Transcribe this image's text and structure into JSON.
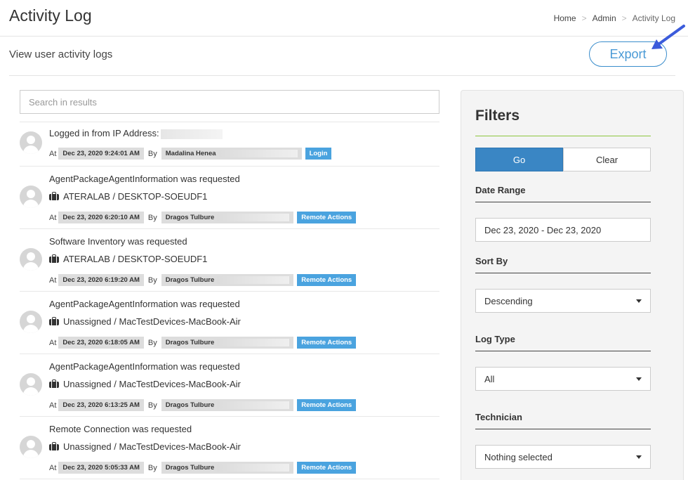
{
  "header": {
    "title": "Activity Log",
    "breadcrumb": [
      "Home",
      "Admin",
      "Activity Log"
    ],
    "separator": ">"
  },
  "subheader": {
    "subtitle": "View user activity logs",
    "export_label": "Export"
  },
  "search": {
    "placeholder": "Search in results"
  },
  "log_labels": {
    "at": "At",
    "by": "By"
  },
  "logs": [
    {
      "title": "Logged in from IP Address:",
      "device": "",
      "date": "Dec 23, 2020 9:24:01 AM",
      "user": "Madalina Henea",
      "type": "Login"
    },
    {
      "title": "AgentPackageAgentInformation was requested",
      "device": "ATERALAB / DESKTOP-SOEUDF1",
      "date": "Dec 23, 2020 6:20:10 AM",
      "user": "Dragos Tulbure",
      "type": "Remote Actions"
    },
    {
      "title": "Software Inventory was requested",
      "device": "ATERALAB / DESKTOP-SOEUDF1",
      "date": "Dec 23, 2020 6:19:20 AM",
      "user": "Dragos Tulbure",
      "type": "Remote Actions"
    },
    {
      "title": "AgentPackageAgentInformation was requested",
      "device": "Unassigned / MacTestDevices-MacBook-Air",
      "date": "Dec 23, 2020 6:18:05 AM",
      "user": "Dragos Tulbure",
      "type": "Remote Actions"
    },
    {
      "title": "AgentPackageAgentInformation was requested",
      "device": "Unassigned / MacTestDevices-MacBook-Air",
      "date": "Dec 23, 2020 6:13:25 AM",
      "user": "Dragos Tulbure",
      "type": "Remote Actions"
    },
    {
      "title": "Remote Connection was requested",
      "device": "Unassigned / MacTestDevices-MacBook-Air",
      "date": "Dec 23, 2020 5:05:33 AM",
      "user": "Dragos Tulbure",
      "type": "Remote Actions"
    }
  ],
  "filters": {
    "title": "Filters",
    "go_label": "Go",
    "clear_label": "Clear",
    "date_range_label": "Date Range",
    "date_range_value": "Dec 23, 2020 - Dec 23, 2020",
    "sort_by_label": "Sort By",
    "sort_by_value": "Descending",
    "log_type_label": "Log Type",
    "log_type_value": "All",
    "technician_label": "Technician",
    "technician_value": "Nothing selected"
  },
  "colors": {
    "accent": "#3a86c4",
    "badge": "#4aa3df",
    "filters_rule": "#8dc63f",
    "annotation_arrow": "#3b5bdb"
  },
  "icons": [
    "briefcase-icon",
    "user-avatar-icon",
    "caret-down-icon",
    "arrow-annotation-icon"
  ]
}
